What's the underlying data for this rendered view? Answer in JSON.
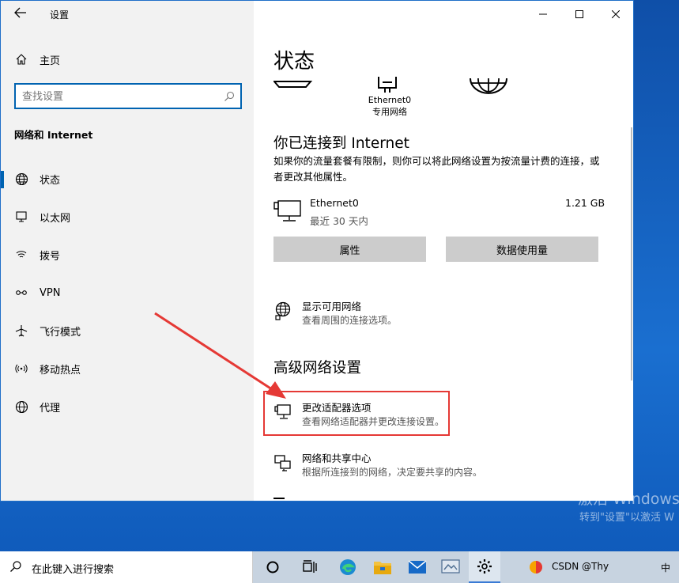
{
  "window": {
    "title": "设置",
    "back_icon": "back-arrow-icon",
    "controls": {
      "minimize": "—",
      "maximize": "☐",
      "close": "✕"
    }
  },
  "sidebar": {
    "home_label": "主页",
    "search_placeholder": "查找设置",
    "section_title": "网络和 Internet",
    "items": [
      {
        "label": "状态",
        "icon": "home-globe-icon",
        "active": true
      },
      {
        "label": "以太网",
        "icon": "ethernet-icon"
      },
      {
        "label": "拨号",
        "icon": "dialup-icon"
      },
      {
        "label": "VPN",
        "icon": "vpn-icon"
      },
      {
        "label": "飞行模式",
        "icon": "airplane-icon"
      },
      {
        "label": "移动热点",
        "icon": "hotspot-icon"
      },
      {
        "label": "代理",
        "icon": "globe-icon"
      }
    ]
  },
  "main": {
    "title": "状态",
    "diagram": {
      "adapter_name": "Ethernet0",
      "network_type": "专用网络"
    },
    "connected_heading": "你已连接到 Internet",
    "connected_desc": "如果你的流量套餐有限制，则你可以将此网络设置为按流量计费的连接，或者更改其他属性。",
    "connection": {
      "name": "Ethernet0",
      "period": "最近 30 天内",
      "usage": "1.21 GB"
    },
    "buttons": {
      "properties": "属性",
      "data_usage": "数据使用量"
    },
    "show_networks": {
      "title": "显示可用网络",
      "desc": "查看周围的连接选项。"
    },
    "advanced_heading": "高级网络设置",
    "change_adapter": {
      "title": "更改适配器选项",
      "desc": "查看网络适配器并更改连接设置。"
    },
    "sharing_center": {
      "title": "网络和共享中心",
      "desc": "根据所连接到的网络，决定要共享的内容。"
    }
  },
  "watermark": {
    "line1": "激活 Windows",
    "line2": "转到\"设置\"以激活 W"
  },
  "taskbar": {
    "search_label": "在此键入进行搜索",
    "tray_text": "CSDN @Thy",
    "tray_lang": "中"
  },
  "colors": {
    "accent": "#0063b1",
    "highlight_box": "#e53935",
    "arrow": "#e53935"
  }
}
